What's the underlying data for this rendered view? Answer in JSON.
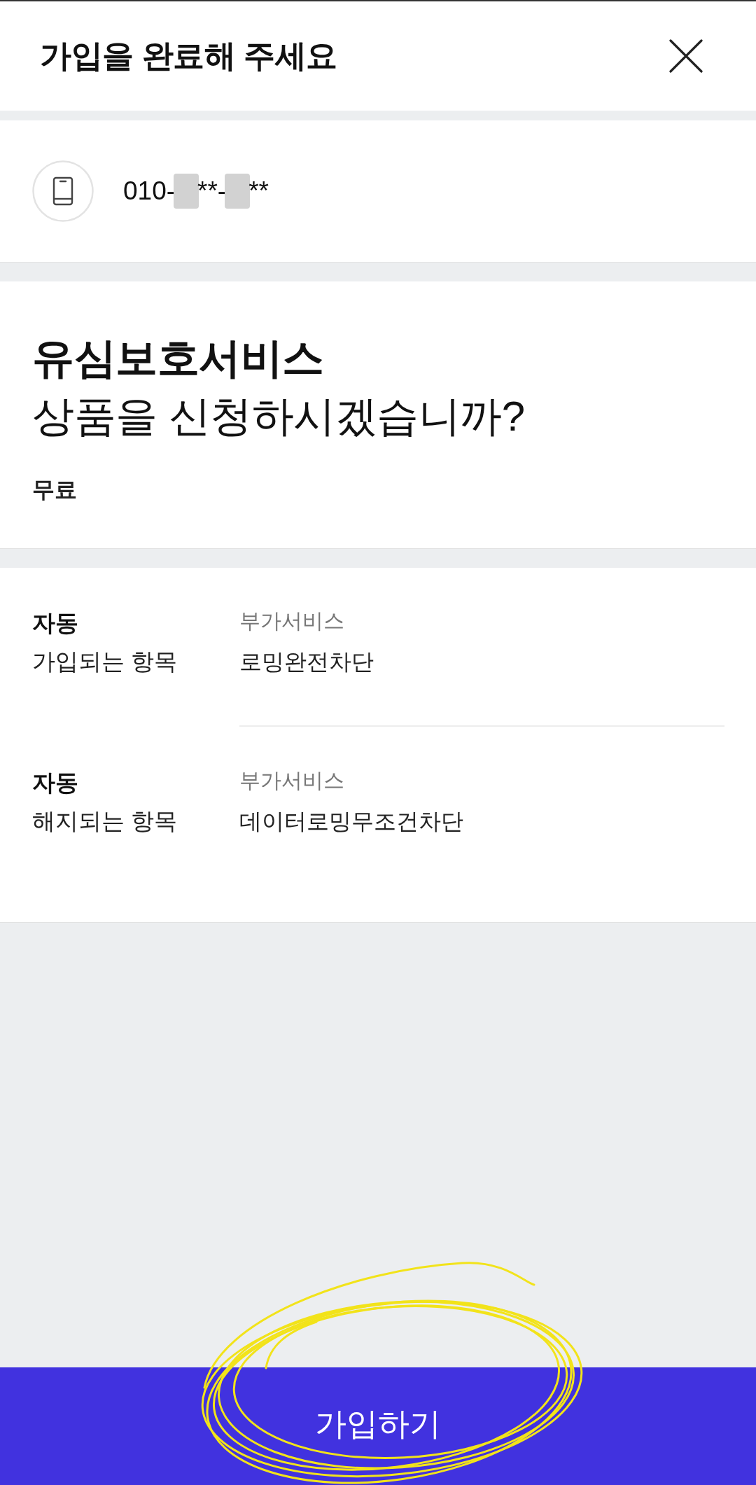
{
  "header": {
    "title": "가입을 완료해 주세요"
  },
  "phone": {
    "number_parts": [
      {
        "kind": "text",
        "text": "010-"
      },
      {
        "kind": "redaction"
      },
      {
        "kind": "text",
        "text": "**-"
      },
      {
        "kind": "redaction"
      },
      {
        "kind": "text",
        "text": "**"
      }
    ]
  },
  "product": {
    "name": "유심보호서비스",
    "question": "상품을 신청하시겠습니까?",
    "price": "무료"
  },
  "changes": [
    {
      "label_bold": "자동",
      "label": "가입되는 항목",
      "category": "부가서비스",
      "item": "로밍완전차단"
    },
    {
      "label_bold": "자동",
      "label": "해지되는 항목",
      "category": "부가서비스",
      "item": "데이터로밍무조건차단"
    }
  ],
  "submit_button": {
    "label": "가입하기"
  },
  "annotation": {
    "kind": "scribble"
  }
}
